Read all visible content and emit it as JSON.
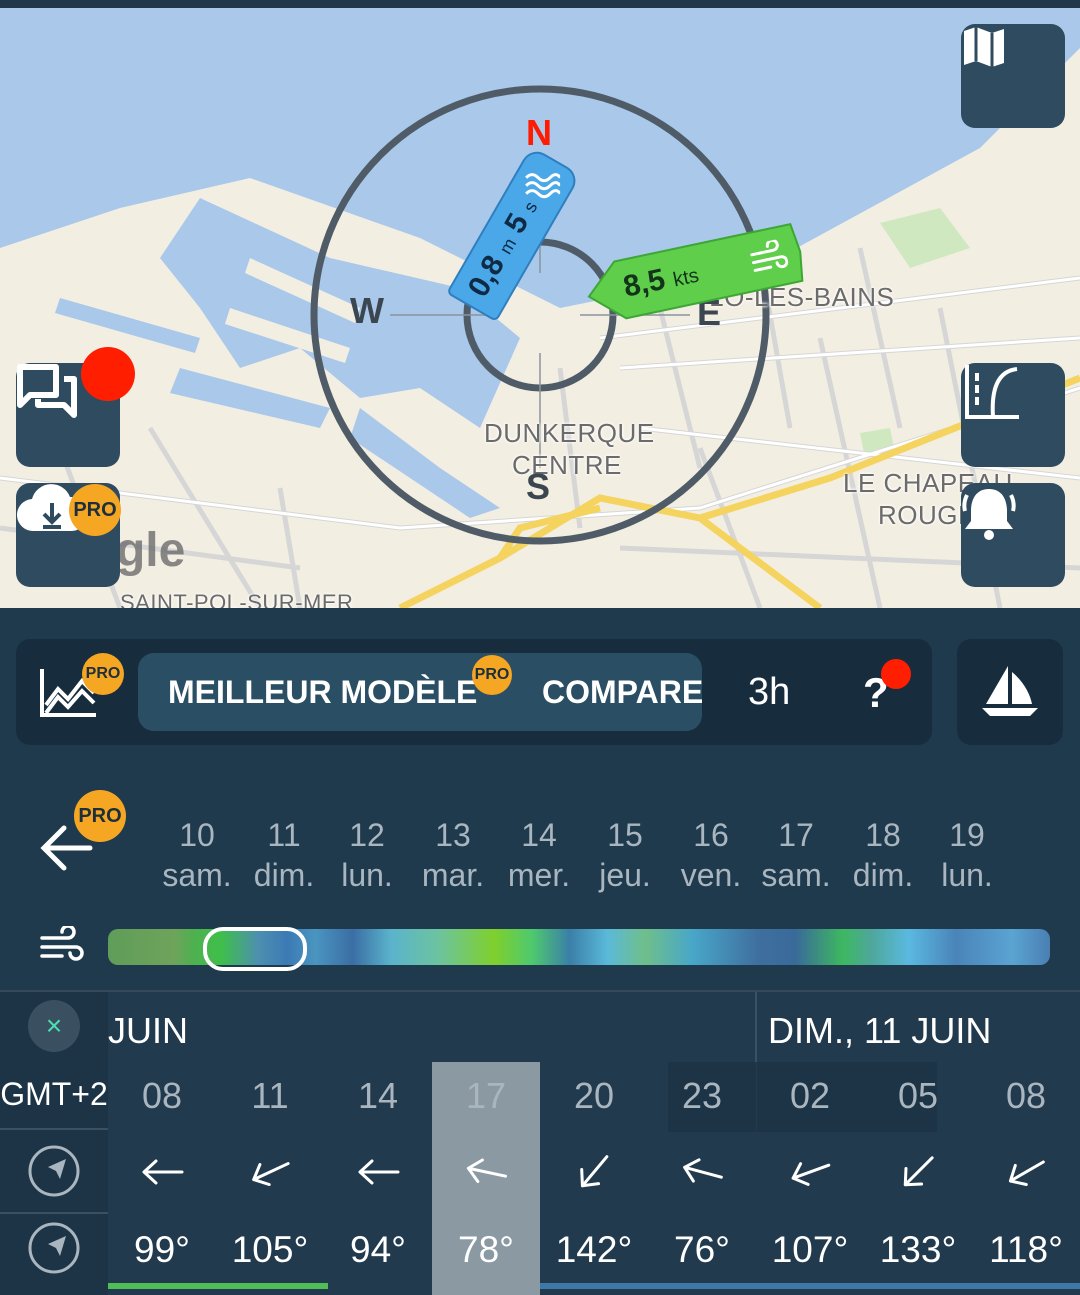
{
  "map": {
    "compass": {
      "north": "N",
      "south": "S",
      "east": "E",
      "west": "W"
    },
    "wave": {
      "value": "0,8",
      "unit": "m",
      "period": "5",
      "period_unit": "s",
      "direction_deg": 30
    },
    "wind": {
      "value": "8,5",
      "unit": "kts",
      "direction_deg": 78
    },
    "labels": {
      "dunkerque_1": "DUNKERQUE",
      "dunkerque_2": "CENTRE",
      "malo": "-LO-LES-BAINS",
      "chapeau_1": "LE CHAPEAU",
      "chapeau_2": "ROUGE",
      "saintpol": "SAINT-POL-SUR-MER",
      "google": "Google"
    },
    "buttons": {
      "pro_label": "PRO"
    }
  },
  "toolbar": {
    "pro_label": "PRO",
    "model_label": "MEILLEUR MODÈLE",
    "compare_label": "COMPARER",
    "interval": "3h",
    "help": "?"
  },
  "days": {
    "pro_label": "PRO",
    "items": [
      {
        "num": "10",
        "name": "sam."
      },
      {
        "num": "11",
        "name": "dim."
      },
      {
        "num": "12",
        "name": "lun."
      },
      {
        "num": "13",
        "name": "mar."
      },
      {
        "num": "14",
        "name": "mer."
      },
      {
        "num": "15",
        "name": "jeu."
      },
      {
        "num": "16",
        "name": "ven."
      },
      {
        "num": "17",
        "name": "sam."
      },
      {
        "num": "18",
        "name": "dim."
      },
      {
        "num": "19",
        "name": "lun."
      }
    ]
  },
  "table": {
    "close": "×",
    "timezone": "GMT+2",
    "header_left": "JUIN",
    "header_right": "DIM., 11 JUIN",
    "times": [
      "08",
      "11",
      "14",
      "17",
      "20",
      "23",
      "02",
      "05",
      "08"
    ],
    "selected_index": 3,
    "wind_dirs": [
      90,
      115,
      90,
      78,
      140,
      75,
      110,
      135,
      120
    ],
    "degrees": [
      "99°",
      "105°",
      "94°",
      "78°",
      "142°",
      "76°",
      "107°",
      "133°",
      "118°"
    ]
  },
  "colors": {
    "accent_orange": "#f5a623",
    "wind_green": "#5fce4b",
    "wave_blue": "#4ba8e8",
    "north_red": "#ff1a00"
  }
}
